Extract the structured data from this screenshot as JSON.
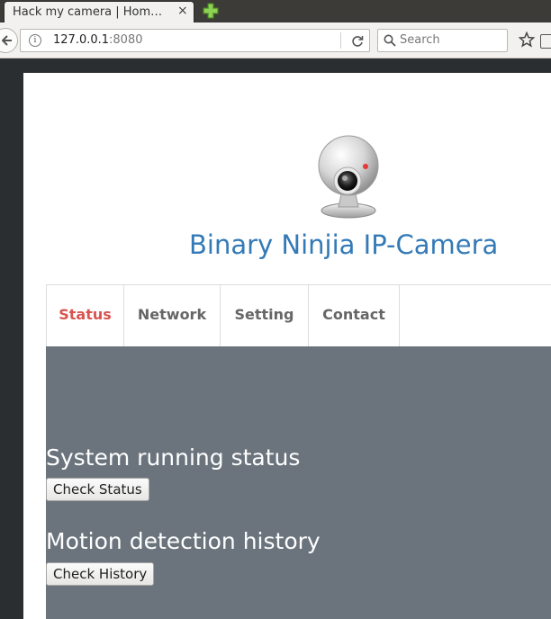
{
  "browser": {
    "tab_title": "Hack my camera | Hom…",
    "tab_close": "×",
    "url_host": "127.0.0.1",
    "url_port": ":8080",
    "search_placeholder": "Search",
    "info_glyph": "i"
  },
  "site": {
    "title": "Binary Ninjia IP-Camera"
  },
  "nav": {
    "tabs": [
      {
        "label": "Status",
        "active": true
      },
      {
        "label": "Network",
        "active": false
      },
      {
        "label": "Setting",
        "active": false
      },
      {
        "label": "Contact",
        "active": false
      }
    ]
  },
  "sections": [
    {
      "title": "System running status",
      "button": "Check Status"
    },
    {
      "title": "Motion detection history",
      "button": "Check History"
    }
  ],
  "colors": {
    "link_blue": "#337ab7",
    "active_tab": "#d9534f",
    "panel_bg": "#6b747d"
  }
}
